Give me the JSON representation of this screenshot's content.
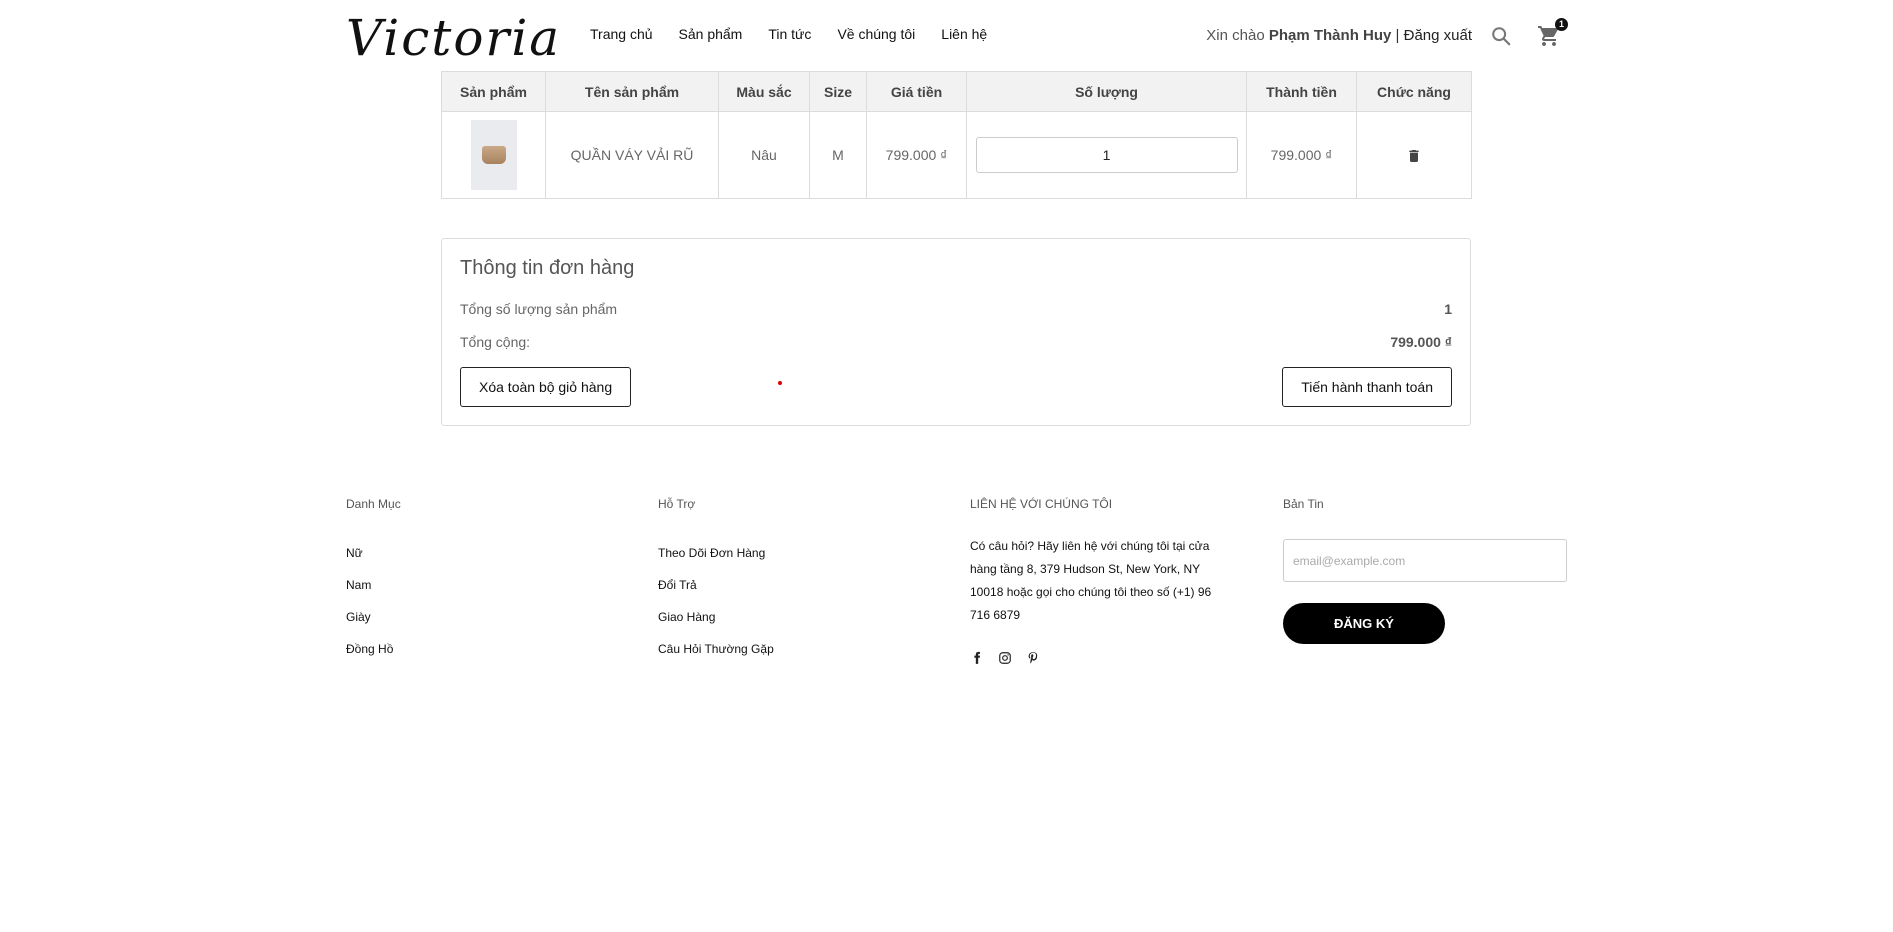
{
  "header": {
    "logo": "Victoria",
    "nav": [
      "Trang chủ",
      "Sản phẩm",
      "Tin tức",
      "Về chúng tôi",
      "Liên hệ"
    ],
    "greeting": "Xin chào",
    "user_name": "Phạm Thành Huy",
    "separator": "|",
    "logout": "Đăng xuất",
    "cart_count": "1"
  },
  "cart": {
    "columns": [
      "Sản phẩm",
      "Tên sản phẩm",
      "Màu sắc",
      "Size",
      "Giá tiền",
      "Số lượng",
      "Thành tiền",
      "Chức năng"
    ],
    "rows": [
      {
        "name": "QUẦN VÁY VẢI RŨ",
        "color": "Nâu",
        "size": "M",
        "price": "799.000 ₫",
        "quantity": "1",
        "total": "799.000 ₫"
      }
    ]
  },
  "order": {
    "title": "Thông tin đơn hàng",
    "total_qty_label": "Tổng số lượng sản phẩm",
    "total_qty_value": "1",
    "total_label": "Tổng cộng:",
    "total_value": "799.000 ₫",
    "clear_button": "Xóa toàn bộ giỏ hàng",
    "checkout_button": "Tiến hành thanh toán"
  },
  "footer": {
    "categories": {
      "title": "Danh Mục",
      "links": [
        "Nữ",
        "Nam",
        "Giày",
        "Đồng Hồ"
      ]
    },
    "support": {
      "title": "Hỗ Trợ",
      "links": [
        "Theo Dõi Đơn Hàng",
        "Đổi Trả",
        "Giao Hàng",
        "Câu Hỏi Thường Gặp"
      ]
    },
    "contact": {
      "title": "LIÊN HỆ VỚI CHÚNG TÔI",
      "text": "Có câu hỏi? Hãy liên hệ với chúng tôi tại cửa hàng tầng 8, 379 Hudson St, New York, NY 10018 hoặc gọi cho chúng tôi theo số (+1) 96 716 6879",
      "socials": [
        "facebook-icon",
        "instagram-icon",
        "pinterest-icon"
      ]
    },
    "newsletter": {
      "title": "Bản Tin",
      "placeholder": "email@example.com",
      "button": "ĐĂNG KÝ"
    }
  }
}
